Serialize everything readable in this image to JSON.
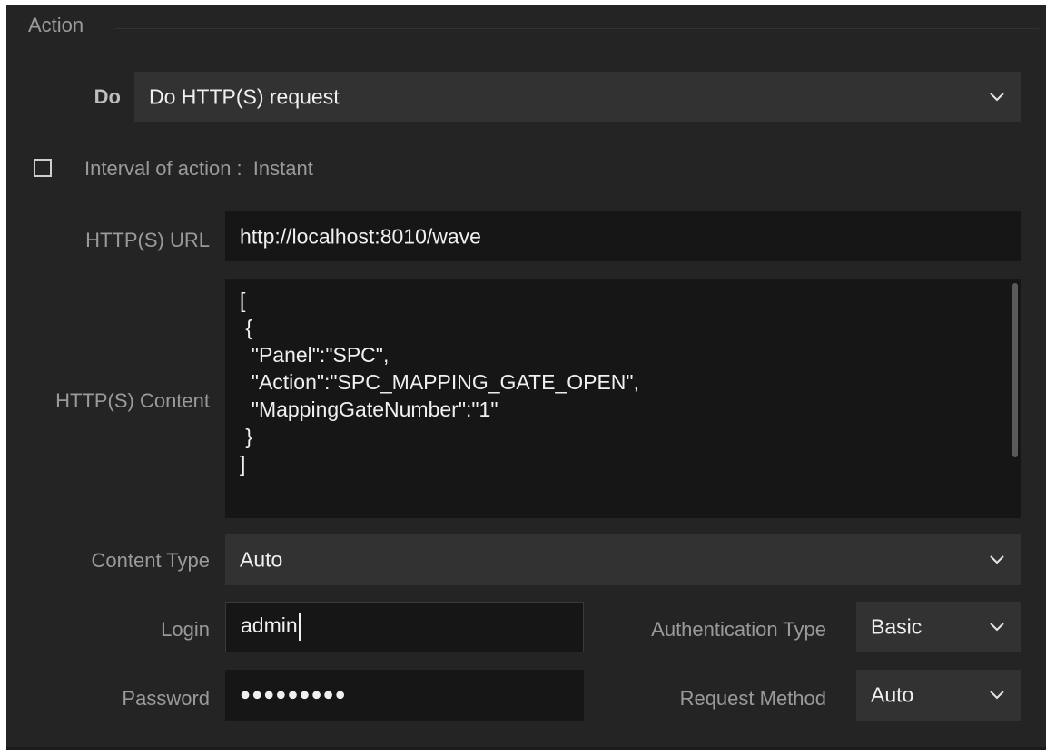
{
  "section": {
    "title": "Action"
  },
  "do": {
    "label": "Do",
    "value": "Do HTTP(S) request"
  },
  "interval": {
    "label": "Interval of action :",
    "value": "Instant",
    "checked": false
  },
  "url": {
    "label": "HTTP(S) URL",
    "value": "http://localhost:8010/wave"
  },
  "content": {
    "label": "HTTP(S) Content",
    "value": "[\n {\n  \"Panel\":\"SPC\",\n  \"Action\":\"SPC_MAPPING_GATE_OPEN\",\n  \"MappingGateNumber\":\"1\"\n }\n]"
  },
  "content_type": {
    "label": "Content Type",
    "value": "Auto"
  },
  "login": {
    "label": "Login",
    "value": "admin"
  },
  "auth_type": {
    "label": "Authentication Type",
    "value": "Basic"
  },
  "password": {
    "label": "Password",
    "value": "●●●●●●●●●"
  },
  "request_method": {
    "label": "Request Method",
    "value": "Auto"
  },
  "icons": {
    "dropdown": "chevron-down-icon",
    "checkbox": "checkbox-icon"
  },
  "colors": {
    "panel_bg": "#242424",
    "input_bg": "#161616",
    "select_bg": "#323232",
    "label": "#9a9a9a"
  }
}
